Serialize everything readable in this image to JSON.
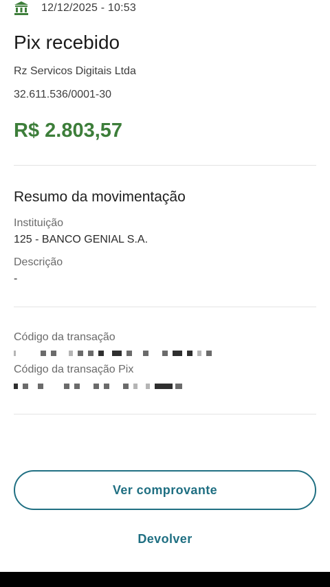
{
  "header": {
    "icon": "bank-icon",
    "datetime": "12/12/2025 - 10:53"
  },
  "title": "Pix recebido",
  "payer": {
    "name": "Rz Servicos Digitais Ltda",
    "document": "32.611.536/0001-30"
  },
  "amount": "R$ 2.803,57",
  "colors": {
    "amount": "#3d7e3a",
    "accent": "#1f6f82"
  },
  "summary": {
    "title": "Resumo da movimentação",
    "institution_label": "Instituição",
    "institution_value": "125 - BANCO GENIAL S.A.",
    "description_label": "Descrição",
    "description_value": "-",
    "transaction_code_label": "Código da transação",
    "pix_code_label": "Código da transação Pix"
  },
  "actions": {
    "receipt_label": "Ver comprovante",
    "refund_label": "Devolver"
  }
}
